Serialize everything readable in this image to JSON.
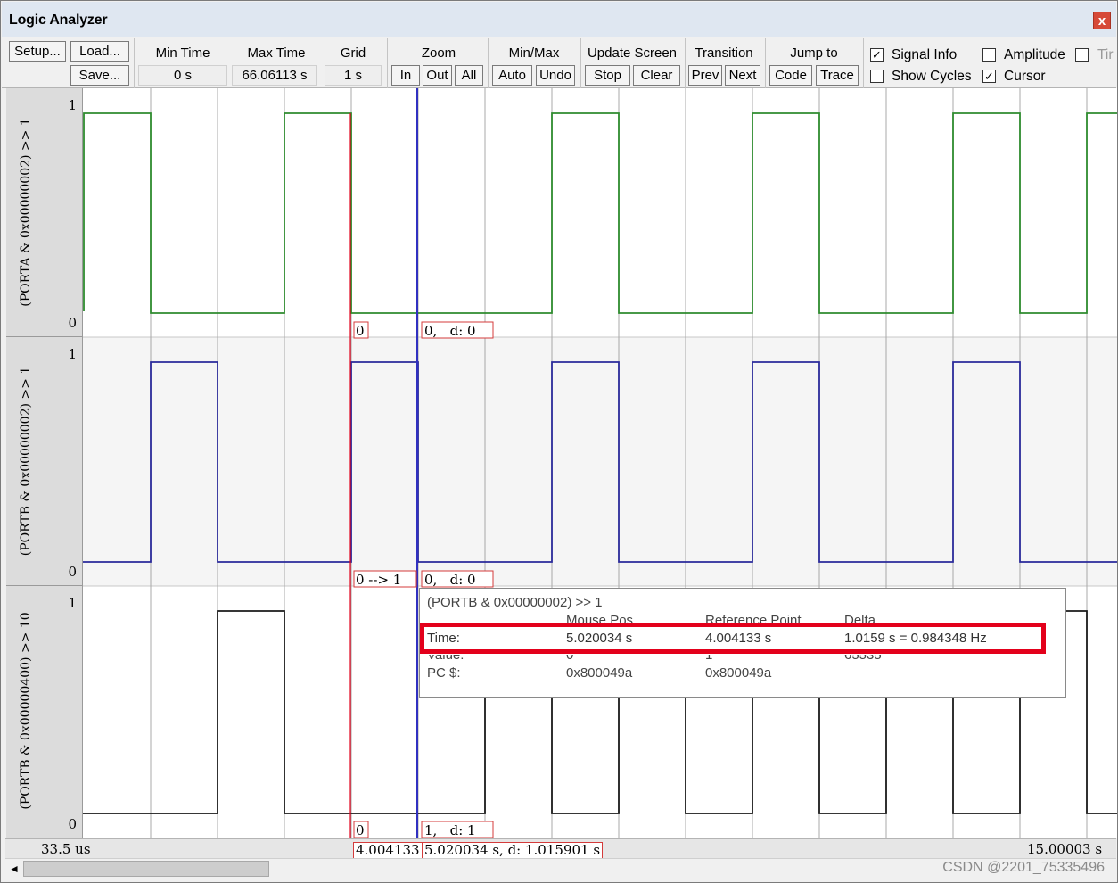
{
  "window": {
    "title": "Logic Analyzer",
    "close_label": "x"
  },
  "toolbar": {
    "setup": "Setup...",
    "load": "Load...",
    "save": "Save...",
    "min_time_label": "Min Time",
    "min_time_value": "0 s",
    "max_time_label": "Max Time",
    "max_time_value": "66.06113 s",
    "grid_label": "Grid",
    "grid_value": "1 s",
    "zoom_label": "Zoom",
    "zoom_in": "In",
    "zoom_out": "Out",
    "zoom_all": "All",
    "minmax_label": "Min/Max",
    "minmax_auto": "Auto",
    "minmax_undo": "Undo",
    "update_label": "Update Screen",
    "update_stop": "Stop",
    "update_clear": "Clear",
    "transition_label": "Transition",
    "transition_prev": "Prev",
    "transition_next": "Next",
    "jump_label": "Jump to",
    "jump_code": "Code",
    "jump_trace": "Trace",
    "signal_info": {
      "label": "Signal Info",
      "checked": true
    },
    "show_cycles": {
      "label": "Show Cycles",
      "checked": false
    },
    "amplitude": {
      "label": "Amplitude",
      "checked": false
    },
    "cursor": {
      "label": "Cursor",
      "checked": true
    },
    "truncated_label": "Tir"
  },
  "signals": [
    {
      "name": "(PORTA & 0x00000002) >> 1",
      "color": "#2e8b2e",
      "high_label": "1",
      "low_label": "0",
      "cursor_value": "0",
      "mouse_value": "0,   d: 0",
      "transitions": [
        0,
        1,
        0,
        1,
        1,
        0,
        1,
        0,
        1,
        0,
        1,
        0,
        1,
        0,
        1
      ]
    },
    {
      "name": "(PORTB & 0x00000002) >> 1",
      "color": "#2a2a9a",
      "high_label": "1",
      "low_label": "0",
      "cursor_value": "0 --> 1",
      "mouse_value": "0,   d: 0",
      "transitions": [
        1,
        0,
        1,
        0,
        0,
        1,
        0,
        1,
        0,
        1,
        0,
        1,
        0,
        1,
        0
      ]
    },
    {
      "name": "(PORTB & 0x00000400) >> 10",
      "color": "#1a1a1a",
      "high_label": "1",
      "low_label": "0",
      "cursor_value": "0",
      "mouse_value": "1,   d: 1"
    }
  ],
  "tooltip": {
    "title": "(PORTB & 0x00000002) >> 1",
    "col_mouse": "Mouse Pos",
    "col_ref": "Reference Point",
    "col_delta": "Delta",
    "time_label": "Time:",
    "time_mouse": "5.020034 s",
    "time_ref": "4.004133 s",
    "time_delta": "1.0159 s = 0.984348 Hz",
    "value_label": "Value:",
    "value_mouse": "0",
    "value_ref": "1",
    "value_delta": "65535",
    "pc_label": "PC $:",
    "pc_mouse": "0x800049a",
    "pc_ref": "0x800049a"
  },
  "time_bar": {
    "start": "33.5  us",
    "ref_time": "4.004133",
    "mouse_time": "5.020034 s,   d: 1.015901 s",
    "end": "15.00003  s"
  },
  "scrollbar": {
    "left_arrow": "◄"
  },
  "watermark": "CSDN @2201_75335496"
}
